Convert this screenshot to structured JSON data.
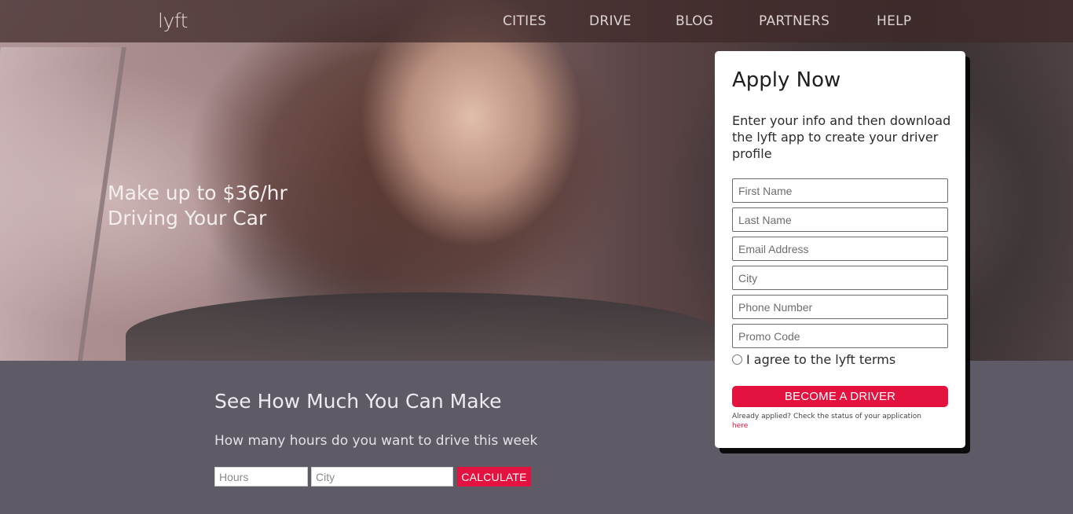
{
  "nav": {
    "logo": "lyft",
    "links": [
      "CITIES",
      "DRIVE",
      "BLOG",
      "PARTNERS",
      "HELP"
    ]
  },
  "hero": {
    "headline_line1": "Make up to $36/hr",
    "headline_line2": "Driving Your Car"
  },
  "apply": {
    "title": "Apply Now",
    "description": "Enter your info and then download the lyft app to create your driver profile",
    "fields": [
      {
        "placeholder": "First Name",
        "value": ""
      },
      {
        "placeholder": "Last Name",
        "value": ""
      },
      {
        "placeholder": "Email Address",
        "value": ""
      },
      {
        "placeholder": "City",
        "value": ""
      },
      {
        "placeholder": "Phone Number",
        "value": ""
      },
      {
        "placeholder": "Promo Code",
        "value": ""
      }
    ],
    "terms_label": "I agree to the lyft terms",
    "button_label": "BECOME A DRIVER",
    "status_note": "Already applied? Check the status of your application",
    "status_link": "here"
  },
  "calculator": {
    "title": "See How Much You Can Make",
    "subtitle": "How many hours do you want to drive this week",
    "hours_placeholder": "Hours",
    "city_placeholder": "City",
    "button_label": "CALCULATE"
  },
  "colors": {
    "accent": "#e4123f",
    "section_bg": "#5e5b66",
    "nav_bg": "#3e2828"
  }
}
